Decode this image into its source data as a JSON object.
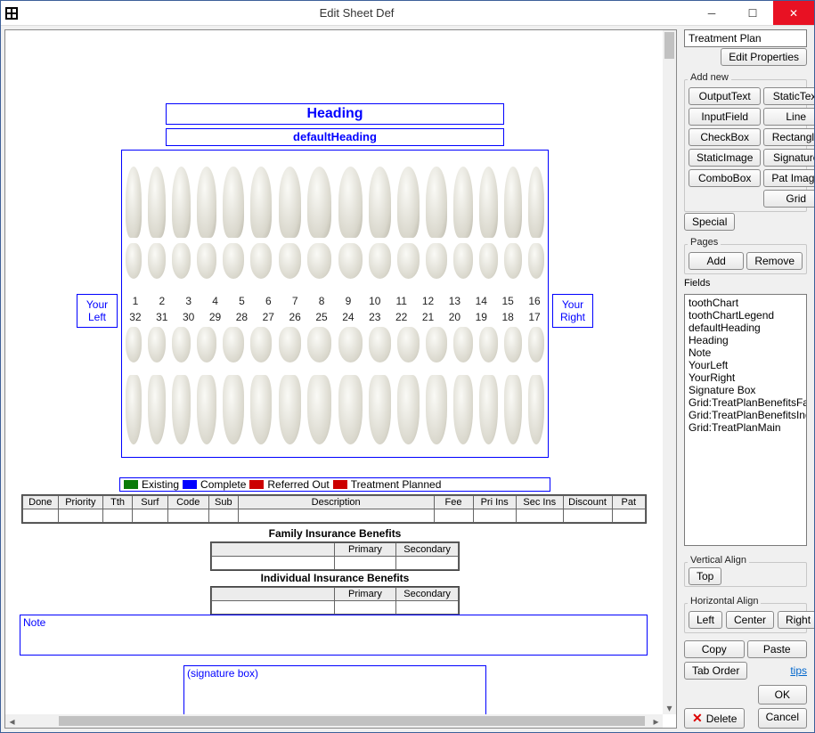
{
  "title": "Edit Sheet Def",
  "side": {
    "sheetName": "Treatment Plan",
    "editProperties": "Edit Properties",
    "addNewLabel": "Add new",
    "addNew": [
      "OutputText",
      "StaticText",
      "InputField",
      "Line",
      "CheckBox",
      "Rectangle",
      "StaticImage",
      "Signature",
      "ComboBox",
      "Pat Image",
      "Grid"
    ],
    "special": "Special",
    "pagesLabel": "Pages",
    "add": "Add",
    "remove": "Remove",
    "fieldsLabel": "Fields",
    "fields": [
      "toothChart",
      "toothChartLegend",
      "defaultHeading",
      "Heading",
      "Note",
      "YourLeft",
      "YourRight",
      "Signature Box",
      "Grid:TreatPlanBenefitsFamily",
      "Grid:TreatPlanBenefitsIndivid",
      "Grid:TreatPlanMain"
    ],
    "vAlignLabel": "Vertical Align",
    "top": "Top",
    "hAlignLabel": "Horizontal Align",
    "left": "Left",
    "center": "Center",
    "right": "Right",
    "copy": "Copy",
    "paste": "Paste",
    "tabOrder": "Tab Order",
    "tips": "tips",
    "ok": "OK",
    "delete": "Delete",
    "cancel": "Cancel"
  },
  "sheet": {
    "heading": "Heading",
    "defaultHeading": "defaultHeading",
    "yourLeft": "Your Left",
    "yourRight": "Your Right",
    "upperNums": [
      "1",
      "2",
      "3",
      "4",
      "5",
      "6",
      "7",
      "8",
      "9",
      "10",
      "11",
      "12",
      "13",
      "14",
      "15",
      "16"
    ],
    "lowerNums": [
      "32",
      "31",
      "30",
      "29",
      "28",
      "27",
      "26",
      "25",
      "24",
      "23",
      "22",
      "21",
      "20",
      "19",
      "18",
      "17"
    ],
    "legend": {
      "existing": "Existing",
      "complete": "Complete",
      "referred": "Referred Out",
      "planned": "Treatment Planned",
      "colors": {
        "existing": "#0a7a0a",
        "complete": "#0000ff",
        "referred": "#cc0000",
        "planned": "#cc0000"
      }
    },
    "mainCols": [
      "Done",
      "Priority",
      "Tth",
      "Surf",
      "Code",
      "Sub",
      "Description",
      "Fee",
      "Pri Ins",
      "Sec Ins",
      "Discount",
      "Pat"
    ],
    "famTitle": "Family Insurance Benefits",
    "indTitle": "Individual Insurance Benefits",
    "benCols": [
      "",
      "Primary",
      "Secondary"
    ],
    "note": "Note",
    "sig": "(signature box)"
  }
}
